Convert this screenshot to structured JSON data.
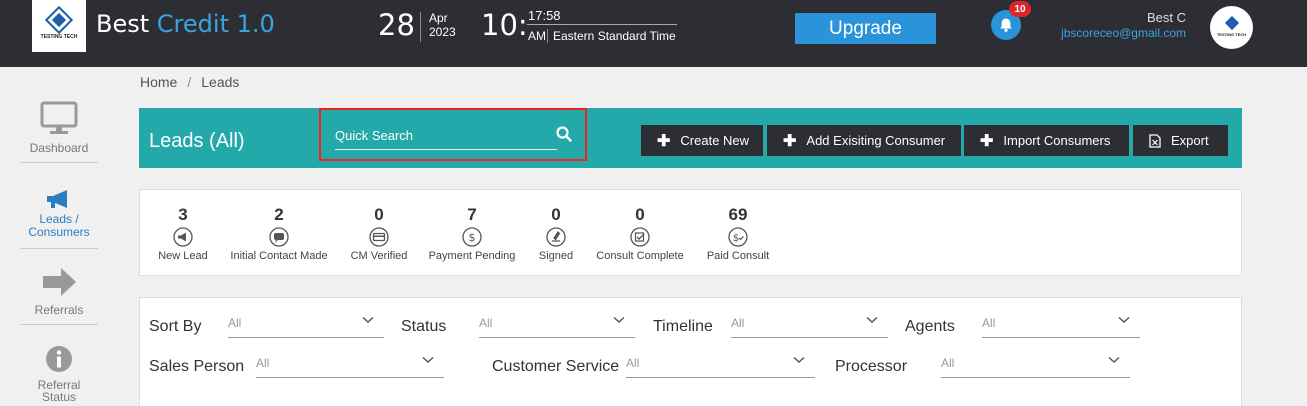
{
  "header": {
    "logo_text": "TESTING TECH",
    "brand_prefix": "Best",
    "brand_accent": "Credit 1.0",
    "date_day": "28",
    "date_month": "Apr",
    "date_year": "2023",
    "time_hour": "10:",
    "time_minutes": "17:58",
    "time_ampm": "AM",
    "timezone": "Eastern Standard Time",
    "upgrade_label": "Upgrade",
    "notification_count": "10",
    "user_name": "Best C",
    "user_email": "jbscoreceo@gmail.com",
    "colors": {
      "topbar": "#2d2e33",
      "accent": "#2a93d9",
      "badge": "#d9262b"
    }
  },
  "sidebar": {
    "items": [
      {
        "label": "Dashboard",
        "icon": "monitor-icon"
      },
      {
        "label": "Leads / Consumers",
        "icon": "megaphone-icon"
      },
      {
        "label": "Referrals",
        "icon": "arrow-right-icon"
      },
      {
        "label": "Referral Status",
        "icon": "info-icon"
      }
    ]
  },
  "breadcrumb": {
    "home": "Home",
    "separator": "/",
    "current": "Leads"
  },
  "leads": {
    "title": "Leads (All)",
    "search_placeholder": "Quick Search",
    "buttons": {
      "create_new": "Create New",
      "add_existing": "Add Exisiting Consumer",
      "import": "Import Consumers",
      "export": "Export"
    },
    "header_color": "#23a9a9"
  },
  "stats": [
    {
      "count": "3",
      "label": "New Lead",
      "icon": "megaphone-icon"
    },
    {
      "count": "2",
      "label": "Initial Contact Made",
      "icon": "chat-icon"
    },
    {
      "count": "0",
      "label": "CM Verified",
      "icon": "card-icon"
    },
    {
      "count": "7",
      "label": "Payment Pending",
      "icon": "dollar-icon"
    },
    {
      "count": "0",
      "label": "Signed",
      "icon": "pen-icon"
    },
    {
      "count": "0",
      "label": "Consult Complete",
      "icon": "checkbox-icon"
    },
    {
      "count": "69",
      "label": "Paid Consult",
      "icon": "dollar-check-icon"
    }
  ],
  "filters": {
    "sort_by": {
      "label": "Sort By",
      "value": "All"
    },
    "status": {
      "label": "Status",
      "value": "All"
    },
    "timeline": {
      "label": "Timeline",
      "value": "All"
    },
    "agents": {
      "label": "Agents",
      "value": "All"
    },
    "sales_person": {
      "label": "Sales Person",
      "value": "All"
    },
    "customer_service": {
      "label": "Customer Service",
      "value": "All"
    },
    "processor": {
      "label": "Processor",
      "value": "All"
    }
  }
}
